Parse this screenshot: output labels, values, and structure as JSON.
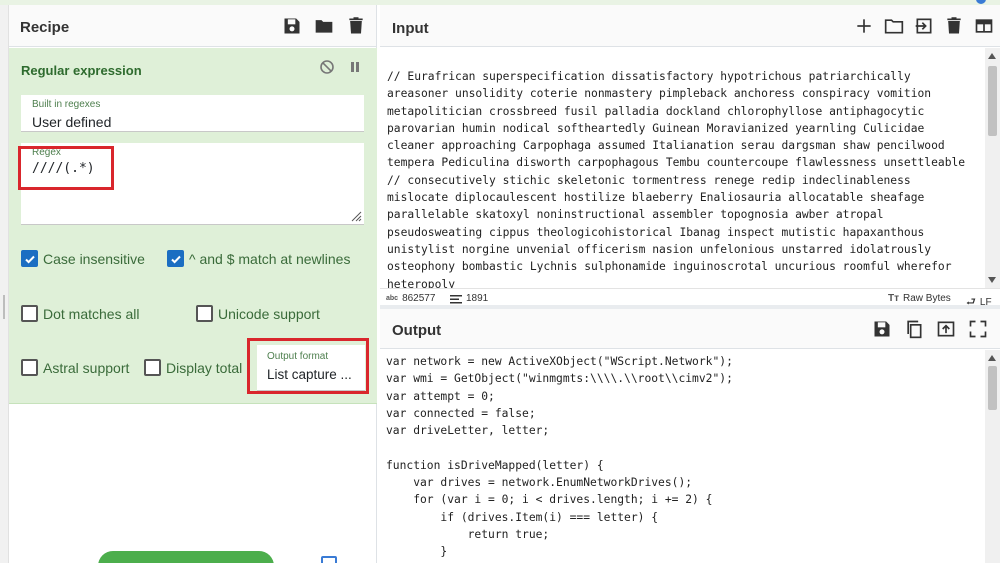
{
  "recipe": {
    "title": "Recipe",
    "header_icons": [
      "save-icon",
      "folder-icon",
      "trash-icon"
    ],
    "operation": {
      "title": "Regular expression",
      "builtin": {
        "label": "Built in regexes",
        "value": "User defined"
      },
      "regex": {
        "label": "Regex",
        "value": "////(.*)"
      },
      "options": {
        "case_insensitive": {
          "label": "Case insensitive",
          "checked": true
        },
        "multiline": {
          "label": "^ and $ match at newlines",
          "checked": true
        },
        "dot_all": {
          "label": "Dot matches all",
          "checked": false
        },
        "unicode": {
          "label": "Unicode support",
          "checked": false
        },
        "astral": {
          "label": "Astral support",
          "checked": false
        },
        "display_total": {
          "label": "Display total",
          "checked": false
        }
      },
      "output_format": {
        "label": "Output format",
        "value": "List capture ..."
      }
    }
  },
  "input": {
    "title": "Input",
    "lines": [
      "// Eurafrican superspecification dissatisfactory hypotrichous patriarchically",
      "areasoner unsolidity coterie nonmastery pimpleback anchoress conspiracy vomition",
      "metapolitician crossbreed fusil palladia dockland chlorophyllose antiphagocytic",
      "parovarian humin nodical softheartedly Guinean Moravianized yearnling Culicidae",
      "cleaner approaching Carpophaga assumed Italianation serau dargsman shaw pencilwood",
      "tempera Pediculina disworth carpophagous Tembu countercoupe flawlessness unsettleable",
      "// consecutively stichic skeletonic tormentress renege redip indeclinableness",
      "mislocate diplocaulescent hostilize blaeberry Enaliosauria allocatable sheafage",
      "parallelable skatoxyl noninstructional assembler topognosia awber atropal",
      "pseudosweating cippus theologicohistorical Ibanag inspect mutistic hapaxanthous",
      "unistylist norgine unvenial officerism nasion unfelonious unstarred idolatrously",
      "osteophony bombastic Lychnis sulphonamide inguinoscrotal uncurious roomful wherefor",
      "heteropoly"
    ],
    "status": {
      "chars": "862577",
      "lines": "1891",
      "encoding": "Raw Bytes",
      "eol": "LF"
    }
  },
  "output": {
    "title": "Output",
    "lines": [
      "var network = new ActiveXObject(\"WScript.Network\");",
      "var wmi = GetObject(\"winmgmts:\\\\\\\\.\\\\root\\\\cimv2\");",
      "var attempt = 0;",
      "var connected = false;",
      "var driveLetter, letter;",
      "",
      "function isDriveMapped(letter) {",
      "    var drives = network.EnumNetworkDrives();",
      "    for (var i = 0; i < drives.length; i += 2) {",
      "        if (drives.Item(i) === letter) {",
      "            return true;",
      "        }"
    ]
  },
  "colors": {
    "operation_bg": "#dff0d8",
    "highlight": "#d9262c",
    "checkbox_on": "#1b6ec2",
    "bake_button": "#4cae4c"
  }
}
